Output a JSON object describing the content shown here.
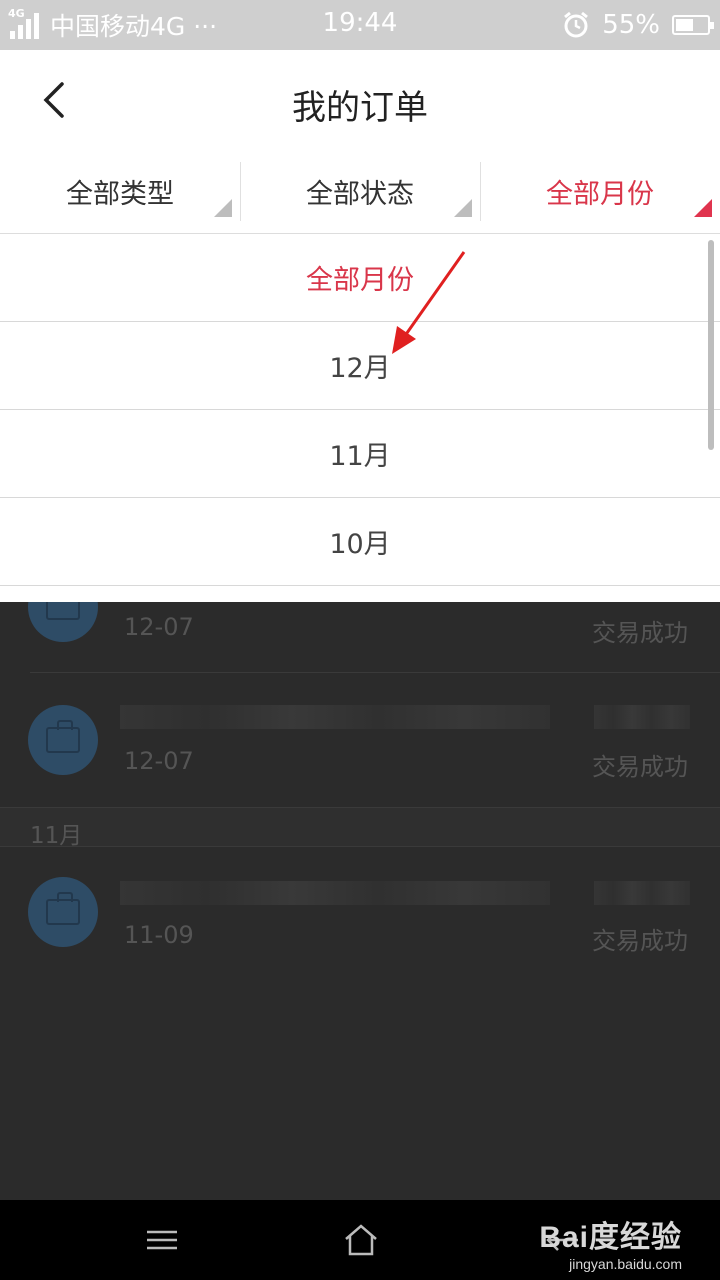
{
  "status_bar": {
    "network_label": "4G",
    "carrier": "中国移动4G ···",
    "time": "19:44",
    "battery": "55%",
    "battery_level": 0.55
  },
  "header": {
    "title": "我的订单"
  },
  "filters": [
    {
      "label": "全部类型",
      "active": false
    },
    {
      "label": "全部状态",
      "active": false
    },
    {
      "label": "全部月份",
      "active": true
    }
  ],
  "dropdown": {
    "options": [
      {
        "label": "全部月份",
        "selected": true
      },
      {
        "label": "12月",
        "selected": false
      },
      {
        "label": "11月",
        "selected": false
      },
      {
        "label": "10月",
        "selected": false
      }
    ]
  },
  "orders": [
    {
      "date": "12-07",
      "status": "交易成功"
    },
    {
      "date": "12-07",
      "status": "交易成功"
    },
    {
      "month_header": "11月"
    },
    {
      "date": "11-09",
      "status": "交易成功"
    }
  ],
  "watermark": {
    "main": "Bai度经验",
    "sub": "jingyan.baidu.com"
  },
  "colors": {
    "accent": "#d9364a",
    "status_bar": "#cfcfcf",
    "overlay": "#2b2b2b"
  }
}
